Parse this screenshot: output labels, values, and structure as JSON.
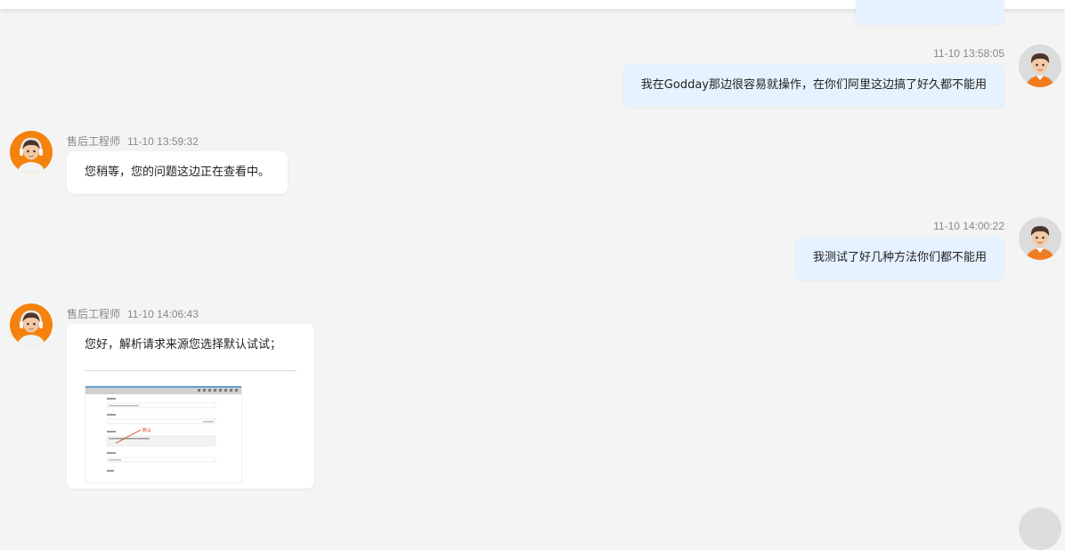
{
  "messages": [
    {
      "side": "right",
      "time": "11-10 13:58:05",
      "text": "我在Godday那边很容易就操作，在你们阿里这边搞了好久都不能用"
    },
    {
      "side": "left",
      "sender": "售后工程师",
      "time": "11-10 13:59:32",
      "text": "您稍等，您的问题这边正在查看中。"
    },
    {
      "side": "right",
      "time": "11-10 14:00:22",
      "text": "我测试了好几种方法你们都不能用"
    },
    {
      "side": "left",
      "sender": "售后工程师",
      "time": "11-10 14:06:43",
      "text": "您好，解析请求来源您选择默认试试；",
      "attachment": {
        "type": "screenshot",
        "annotation": "默认"
      }
    }
  ],
  "colors": {
    "background": "#f4f4f4",
    "my_bubble": "#e5f2ff",
    "their_bubble": "#ffffff",
    "meta_text": "#888888"
  },
  "icons": {
    "user_avatar": "user-avatar-icon",
    "agent_avatar": "support-agent-avatar-icon"
  }
}
